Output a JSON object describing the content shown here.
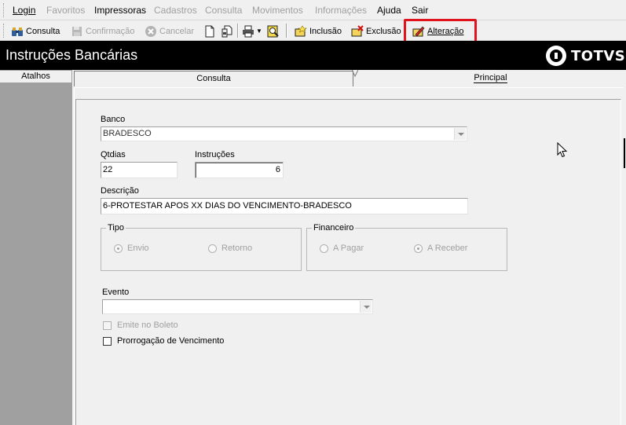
{
  "menu": {
    "items": [
      {
        "label": "Login",
        "enabled": true
      },
      {
        "label": "Favoritos",
        "enabled": false
      },
      {
        "label": "Impressoras",
        "enabled": true
      },
      {
        "label": "Cadastros",
        "enabled": false
      },
      {
        "label": "Consulta",
        "enabled": false
      },
      {
        "label": "Movimentos",
        "enabled": false
      },
      {
        "label": "Informações",
        "enabled": false
      },
      {
        "label": "Ajuda",
        "enabled": true
      },
      {
        "label": "Sair",
        "enabled": true
      }
    ]
  },
  "toolbar": {
    "consulta": "Consulta",
    "confirmacao": "Confirmação",
    "cancelar": "Cancelar",
    "inclusao": "Inclusão",
    "exclusao": "Exclusão",
    "alteracao": "Alteração",
    "highlight_color": "#e0141e"
  },
  "window": {
    "title": "Instruções Bancárias",
    "logo_text": "TOTVS"
  },
  "sidebar": {
    "header": "Atalhos"
  },
  "tabs": {
    "consulta": "Consulta",
    "principal": "Principal"
  },
  "form": {
    "banco_label": "Banco",
    "banco_value": "BRADESCO",
    "qtdias_label": "Qtdias",
    "qtdias_value": "22",
    "instrucoes_label": "Instruções",
    "instrucoes_value": "6",
    "descricao_label": "Descrição",
    "descricao_value": "6-PROTESTAR APOS XX DIAS DO VENCIMENTO-BRADESCO",
    "tipo_label": "Tipo",
    "tipo_envio": "Envio",
    "tipo_retorno": "Retorno",
    "financeiro_label": "Financeiro",
    "fin_pagar": "A Pagar",
    "fin_receber": "A Receber",
    "evento_label": "Evento",
    "evento_value": "",
    "emite_boleto": "Emite no Boleto",
    "prorrogacao": "Prorrogação de Vencimento"
  }
}
